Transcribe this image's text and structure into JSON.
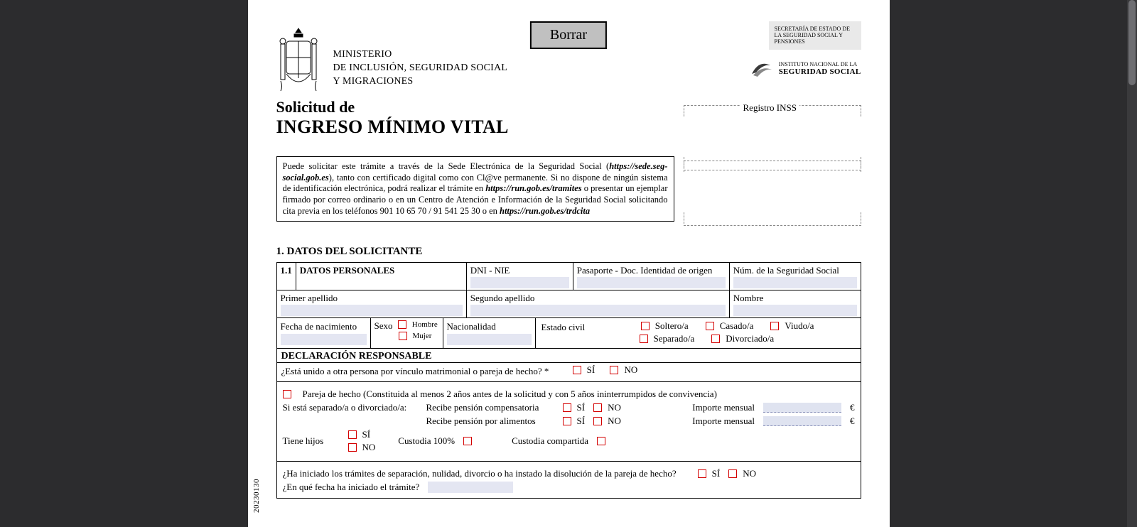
{
  "viewer": {
    "borrar": "Borrar"
  },
  "header": {
    "ministry_l1": "MINISTERIO",
    "ministry_l2": "DE INCLUSIÓN, SEGURIDAD SOCIAL",
    "ministry_l3": "Y MIGRACIONES",
    "secretaria": "SECRETARÍA DE ESTADO DE LA SEGURIDAD SOCIAL Y PENSIONES",
    "inss_small": "INSTITUTO NACIONAL DE LA",
    "inss_big": "SEGURIDAD SOCIAL"
  },
  "title": {
    "line1": "Solicitud de",
    "line2": "INGRESO MÍNIMO VITAL"
  },
  "registro": "Registro INSS",
  "info": {
    "t1": "Puede solicitar este trámite a través de la Sede Electrónica de la Seguridad Social (",
    "u1": "https://sede.seg-social.gob.es",
    "t2": "), tanto con certificado digital como con Cl@ve permanente. Si no dispone de ningún sistema de identificación electrónica, podrá realizar el trámite en ",
    "u2": "https://run.gob.es/tramites",
    "t3": " o presentar un ejemplar firmado por correo ordinario o en un Centro de Atención e Información de la Seguridad Social solicitando cita previa en los teléfonos 901 10 65 70 / 91 541 25 30 o en ",
    "u3": "https://run.gob.es/trdcita"
  },
  "s1": {
    "heading": "1. DATOS DEL SOLICITANTE",
    "num11": "1.1",
    "datos_personales": "DATOS PERSONALES",
    "dni": "DNI - NIE",
    "pasaporte": "Pasaporte - Doc. Identidad de origen",
    "nss": "Núm. de la Seguridad Social",
    "primer_ap": "Primer apellido",
    "segundo_ap": "Segundo apellido",
    "nombre": "Nombre",
    "fecha_nac": "Fecha de nacimiento",
    "sexo": "Sexo",
    "hombre": "Hombre",
    "mujer": "Mujer",
    "nacionalidad": "Nacionalidad",
    "estado_civil": "Estado civil",
    "soltero": "Soltero/a",
    "casado": "Casado/a",
    "viudo": "Viudo/a",
    "separado": "Separado/a",
    "divorciado": "Divorciado/a"
  },
  "declar": {
    "title": "DECLARACIÓN RESPONSABLE",
    "q1": "¿Está unido a otra persona por vínculo matrimonial o pareja de hecho? *",
    "si": "SÍ",
    "no": "NO",
    "pareja": "Pareja de hecho (Constituida al menos 2 años  antes de la solicitud y con 5 años ininterrumpidos de convivencia)",
    "separado_div": "Si está separado/a o divorciado/a:",
    "pension_comp": "Recibe pensión compensatoria",
    "pension_alim": "Recibe pensión por alimentos",
    "importe": "Importe mensual",
    "tiene_hijos": "Tiene hijos",
    "custodia100": "Custodia  100%",
    "custodia_comp": "Custodia compartida",
    "q_tramites": "¿Ha iniciado los trámites de separación, nulidad, divorcio o ha instado la disolución de la pareja de hecho?",
    "q_fecha": "¿En qué fecha ha iniciado el trámite?"
  },
  "sidecode": "20230130"
}
